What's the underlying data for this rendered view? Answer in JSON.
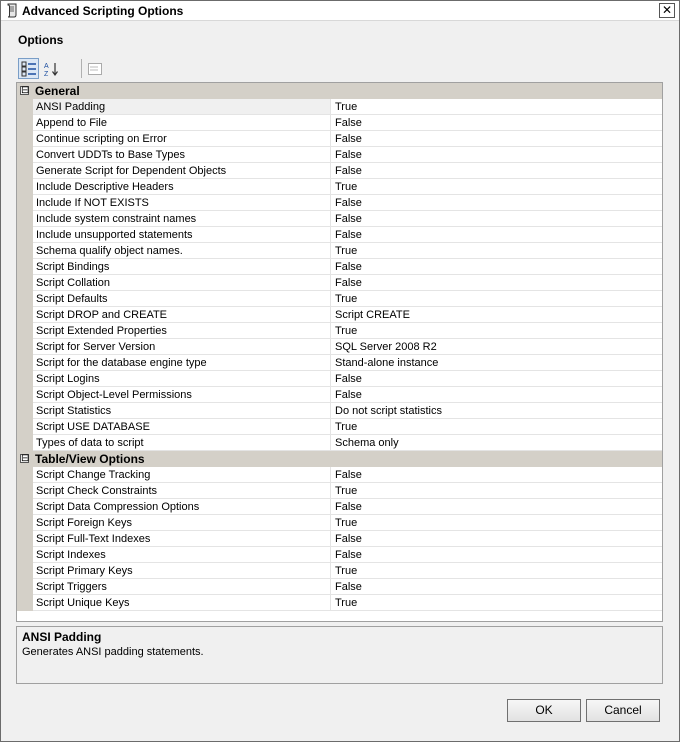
{
  "window": {
    "title": "Advanced Scripting Options"
  },
  "section_label": "Options",
  "toolbar": {
    "buttons": [
      "categorized-icon",
      "alphabetical-icon",
      "property-pages-icon"
    ]
  },
  "grid": {
    "categories": [
      {
        "expander": "⊟",
        "label": "General",
        "rows": [
          {
            "name": "ANSI Padding",
            "value": "True"
          },
          {
            "name": "Append to File",
            "value": "False"
          },
          {
            "name": "Continue scripting on Error",
            "value": "False"
          },
          {
            "name": "Convert UDDTs to Base Types",
            "value": "False"
          },
          {
            "name": "Generate Script for Dependent Objects",
            "value": "False"
          },
          {
            "name": "Include Descriptive Headers",
            "value": "True"
          },
          {
            "name": "Include If NOT EXISTS",
            "value": "False"
          },
          {
            "name": "Include system constraint names",
            "value": "False"
          },
          {
            "name": "Include unsupported statements",
            "value": "False"
          },
          {
            "name": "Schema qualify object names.",
            "value": "True"
          },
          {
            "name": "Script Bindings",
            "value": "False"
          },
          {
            "name": "Script Collation",
            "value": "False"
          },
          {
            "name": "Script Defaults",
            "value": "True"
          },
          {
            "name": "Script DROP and CREATE",
            "value": "Script CREATE"
          },
          {
            "name": "Script Extended Properties",
            "value": "True"
          },
          {
            "name": "Script for Server Version",
            "value": "SQL Server 2008 R2"
          },
          {
            "name": "Script for the database engine type",
            "value": "Stand-alone instance"
          },
          {
            "name": "Script Logins",
            "value": "False"
          },
          {
            "name": "Script Object-Level Permissions",
            "value": "False"
          },
          {
            "name": "Script Statistics",
            "value": "Do not script statistics"
          },
          {
            "name": "Script USE DATABASE",
            "value": "True"
          },
          {
            "name": "Types of data to script",
            "value": "Schema only"
          }
        ]
      },
      {
        "expander": "⊟",
        "label": "Table/View Options",
        "rows": [
          {
            "name": "Script Change Tracking",
            "value": "False"
          },
          {
            "name": "Script Check Constraints",
            "value": "True"
          },
          {
            "name": "Script Data Compression Options",
            "value": "False"
          },
          {
            "name": "Script Foreign Keys",
            "value": "True"
          },
          {
            "name": "Script Full-Text Indexes",
            "value": "False"
          },
          {
            "name": "Script Indexes",
            "value": "False"
          },
          {
            "name": "Script Primary Keys",
            "value": "True"
          },
          {
            "name": "Script Triggers",
            "value": "False"
          },
          {
            "name": "Script Unique Keys",
            "value": "True"
          }
        ]
      }
    ]
  },
  "description": {
    "title": "ANSI Padding",
    "text": "Generates ANSI padding statements."
  },
  "buttons": {
    "ok": "OK",
    "cancel": "Cancel"
  }
}
